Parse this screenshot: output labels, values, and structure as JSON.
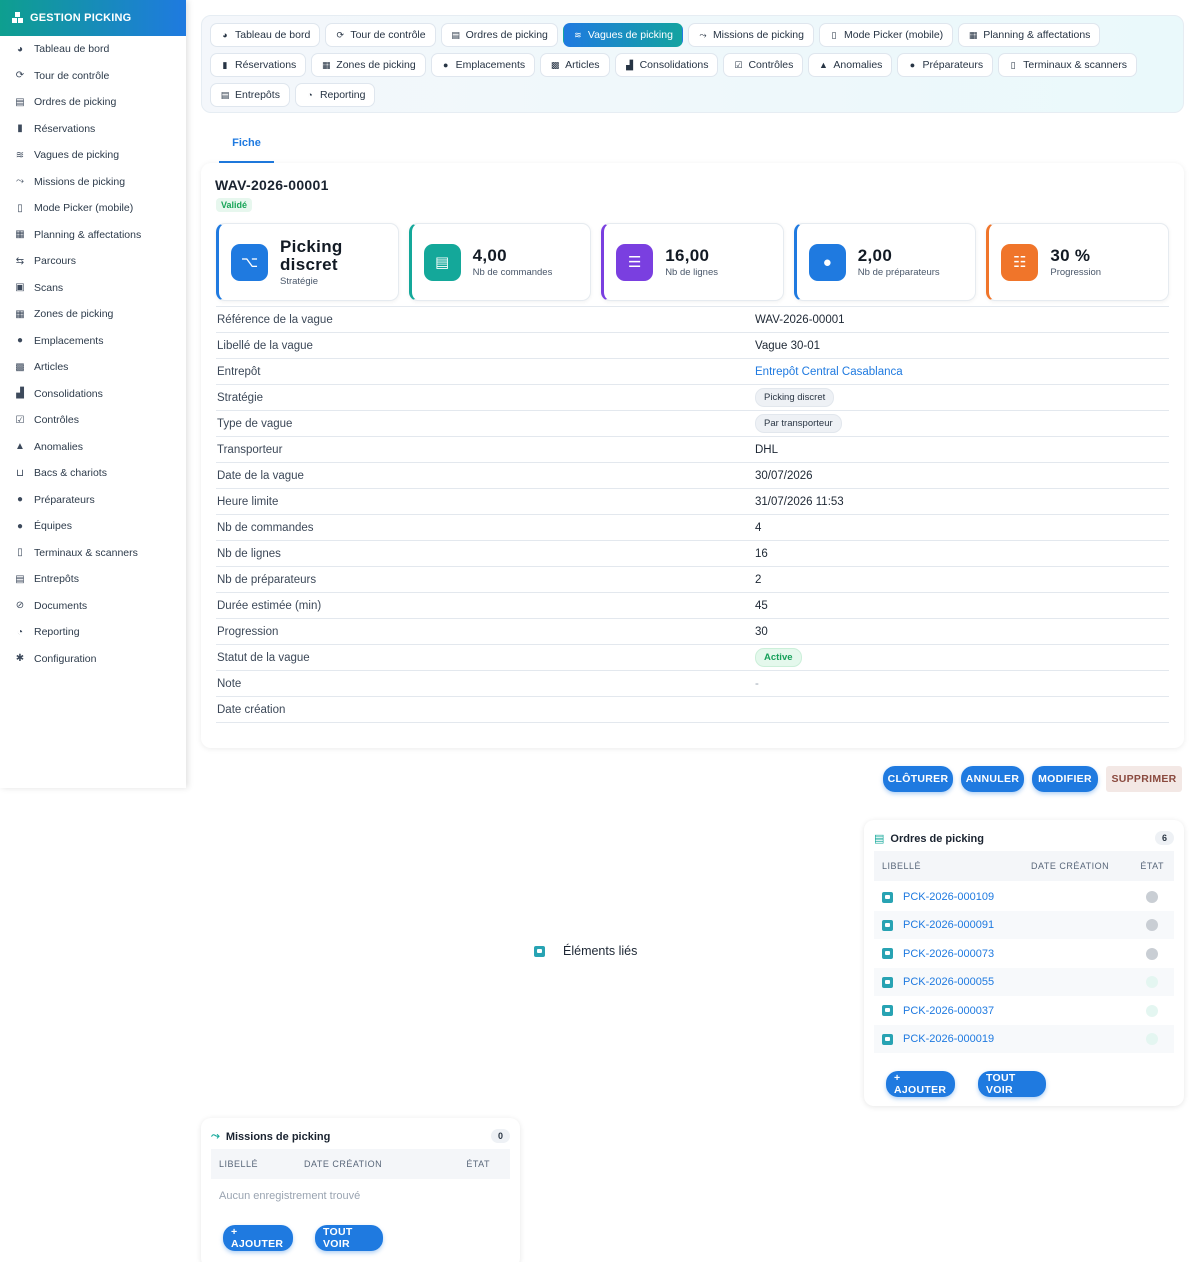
{
  "sidebar": {
    "brand": "GESTION PICKING",
    "items": [
      {
        "label": "Tableau de bord",
        "icon": "dashboard-icon",
        "glyph": "◕"
      },
      {
        "label": "Tour de contrôle",
        "icon": "satellite-icon",
        "glyph": "⟳"
      },
      {
        "label": "Ordres de picking",
        "icon": "clipboard-icon",
        "glyph": "▤"
      },
      {
        "label": "Réservations",
        "icon": "bookmark-icon",
        "glyph": "▮"
      },
      {
        "label": "Vagues de picking",
        "icon": "layers-icon",
        "glyph": "≋"
      },
      {
        "label": "Missions de picking",
        "icon": "route-icon",
        "glyph": "⤳"
      },
      {
        "label": "Mode Picker (mobile)",
        "icon": "mobile-icon",
        "glyph": "▯"
      },
      {
        "label": "Planning & affectations",
        "icon": "calendar-icon",
        "glyph": "▦"
      },
      {
        "label": "Parcours",
        "icon": "signs-icon",
        "glyph": "⇆"
      },
      {
        "label": "Scans",
        "icon": "qrcode-icon",
        "glyph": "▣"
      },
      {
        "label": "Zones de picking",
        "icon": "grid-icon",
        "glyph": "▦"
      },
      {
        "label": "Emplacements",
        "icon": "location-pin-icon",
        "glyph": "●"
      },
      {
        "label": "Articles",
        "icon": "boxes-icon",
        "glyph": "▩"
      },
      {
        "label": "Consolidations",
        "icon": "cubes-icon",
        "glyph": "▟"
      },
      {
        "label": "Contrôles",
        "icon": "clipboard-check-icon",
        "glyph": "☑"
      },
      {
        "label": "Anomalies",
        "icon": "warning-icon",
        "glyph": "▲"
      },
      {
        "label": "Bacs & chariots",
        "icon": "basket-icon",
        "glyph": "⊔"
      },
      {
        "label": "Préparateurs",
        "icon": "user-gear-icon",
        "glyph": "●"
      },
      {
        "label": "Équipes",
        "icon": "users-icon",
        "glyph": "●"
      },
      {
        "label": "Terminaux & scanners",
        "icon": "mobile-icon",
        "glyph": "▯"
      },
      {
        "label": "Entrepôts",
        "icon": "warehouse-icon",
        "glyph": "▤"
      },
      {
        "label": "Documents",
        "icon": "paperclip-icon",
        "glyph": "⊘"
      },
      {
        "label": "Reporting",
        "icon": "pie-chart-icon",
        "glyph": "◔"
      },
      {
        "label": "Configuration",
        "icon": "gear-icon",
        "glyph": "✱"
      }
    ]
  },
  "topnav": {
    "row1": [
      {
        "label": "Tableau de bord",
        "icon": "dashboard-icon",
        "glyph": "◕"
      },
      {
        "label": "Tour de contrôle",
        "icon": "satellite-icon",
        "glyph": "⟳"
      },
      {
        "label": "Ordres de picking",
        "icon": "clipboard-icon",
        "glyph": "▤"
      },
      {
        "label": "Vagues de picking",
        "icon": "layers-icon",
        "glyph": "≋",
        "active": true
      },
      {
        "label": "Missions de picking",
        "icon": "route-icon",
        "glyph": "⤳"
      },
      {
        "label": "Mode Picker (mobile)",
        "icon": "mobile-icon",
        "glyph": "▯"
      },
      {
        "label": "Planning & affectations",
        "icon": "calendar-icon",
        "glyph": "▦"
      }
    ],
    "row2": [
      {
        "label": "Réservations",
        "icon": "bookmark-icon",
        "glyph": "▮"
      },
      {
        "label": "Zones de picking",
        "icon": "grid-icon",
        "glyph": "▦"
      },
      {
        "label": "Emplacements",
        "icon": "location-pin-icon",
        "glyph": "●"
      },
      {
        "label": "Articles",
        "icon": "boxes-icon",
        "glyph": "▩"
      },
      {
        "label": "Consolidations",
        "icon": "cubes-icon",
        "glyph": "▟"
      },
      {
        "label": "Contrôles",
        "icon": "clipboard-check-icon",
        "glyph": "☑"
      },
      {
        "label": "Anomalies",
        "icon": "warning-icon",
        "glyph": "▲"
      },
      {
        "label": "Préparateurs",
        "icon": "user-gear-icon",
        "glyph": "●"
      },
      {
        "label": "Terminaux & scanners",
        "icon": "mobile-icon",
        "glyph": "▯"
      }
    ],
    "row3": [
      {
        "label": "Entrepôts",
        "icon": "warehouse-icon",
        "glyph": "▤"
      },
      {
        "label": "Reporting",
        "icon": "pie-chart-icon",
        "glyph": "◔"
      }
    ]
  },
  "tab": {
    "label": "Fiche"
  },
  "record": {
    "title": "WAV-2026-00001",
    "status_badge": "Validé"
  },
  "kpis": [
    {
      "value": "Picking discret",
      "label": "Stratégie",
      "color": "#1f7ae0",
      "icon": "sitemap-icon",
      "glyph": "⌥"
    },
    {
      "value": "4,00",
      "label": "Nb de commandes",
      "color": "#14a89a",
      "icon": "clipboard-icon",
      "glyph": "▤"
    },
    {
      "value": "16,00",
      "label": "Nb de lignes",
      "color": "#7a3fe0",
      "icon": "list-icon",
      "glyph": "☰"
    },
    {
      "value": "2,00",
      "label": "Nb de préparateurs",
      "color": "#1f7ae0",
      "icon": "user-tag-icon",
      "glyph": "●"
    },
    {
      "value": "30 %",
      "label": "Progression",
      "color": "#f0752a",
      "icon": "list-check-icon",
      "glyph": "☷"
    }
  ],
  "details": [
    {
      "label": "Référence de la vague",
      "value": "WAV-2026-00001",
      "kind": "text"
    },
    {
      "label": "Libellé de la vague",
      "value": "Vague 30-01",
      "kind": "text"
    },
    {
      "label": "Entrepôt",
      "value": "Entrepôt Central Casablanca",
      "kind": "link"
    },
    {
      "label": "Stratégie",
      "value": "Picking discret",
      "kind": "chip"
    },
    {
      "label": "Type de vague",
      "value": "Par transporteur",
      "kind": "chip"
    },
    {
      "label": "Transporteur",
      "value": "DHL",
      "kind": "text"
    },
    {
      "label": "Date de la vague",
      "value": "30/07/2026",
      "kind": "text"
    },
    {
      "label": "Heure limite",
      "value": "31/07/2026 11:53",
      "kind": "text"
    },
    {
      "label": "Nb de commandes",
      "value": "4",
      "kind": "text"
    },
    {
      "label": "Nb de lignes",
      "value": "16",
      "kind": "text"
    },
    {
      "label": "Nb de préparateurs",
      "value": "2",
      "kind": "text"
    },
    {
      "label": "Durée estimée (min)",
      "value": "45",
      "kind": "text"
    },
    {
      "label": "Progression",
      "value": "30",
      "kind": "text"
    },
    {
      "label": "Statut de la vague",
      "value": "Active",
      "kind": "chip-green"
    },
    {
      "label": "Note",
      "value": "-",
      "kind": "muted"
    },
    {
      "label": "Date création",
      "value": "",
      "kind": "text"
    }
  ],
  "actions": {
    "close": "CLÔTURER",
    "cancel": "ANNULER",
    "edit": "MODIFIER",
    "delete": "SUPPRIMER"
  },
  "linked": {
    "label": "Éléments liés"
  },
  "orders_panel": {
    "title": "Ordres de picking",
    "count": "6",
    "columns": [
      "LIBELLÉ",
      "DATE CRÉATION",
      "ÉTAT"
    ],
    "rows": [
      {
        "ref": "PCK-2026-000109",
        "state_color": "#c9ced4"
      },
      {
        "ref": "PCK-2026-000091",
        "state_color": "#c9ced4"
      },
      {
        "ref": "PCK-2026-000073",
        "state_color": "#c9ced4"
      },
      {
        "ref": "PCK-2026-000055",
        "state_color": "#e4f6f1"
      },
      {
        "ref": "PCK-2026-000037",
        "state_color": "#e4f6f1"
      },
      {
        "ref": "PCK-2026-000019",
        "state_color": "#e4f6f1"
      }
    ],
    "add_label": "+ AJOUTER",
    "view_all_label": "TOUT VOIR"
  },
  "missions_panel": {
    "title": "Missions de picking",
    "count": "0",
    "columns": [
      "LIBELLÉ",
      "DATE CRÉATION",
      "ÉTAT"
    ],
    "empty": "Aucun enregistrement trouvé",
    "add_label": "+ AJOUTER",
    "view_all_label": "TOUT VOIR"
  }
}
